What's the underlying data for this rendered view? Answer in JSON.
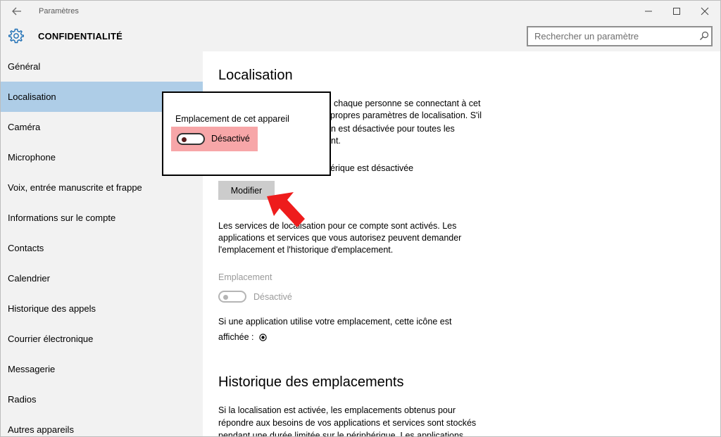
{
  "window": {
    "app_title": "Paramètres"
  },
  "header": {
    "section_title": "CONFIDENTIALITÉ",
    "search_placeholder": "Rechercher un paramètre"
  },
  "sidebar": {
    "active_index": 1,
    "items": [
      {
        "label": "Général"
      },
      {
        "label": "Localisation"
      },
      {
        "label": "Caméra"
      },
      {
        "label": "Microphone"
      },
      {
        "label": "Voix, entrée manuscrite et frappe"
      },
      {
        "label": "Informations sur le compte"
      },
      {
        "label": "Contacts"
      },
      {
        "label": "Calendrier"
      },
      {
        "label": "Historique des appels"
      },
      {
        "label": "Courrier électronique"
      },
      {
        "label": "Messagerie"
      },
      {
        "label": "Radios"
      },
      {
        "label": "Autres appareils"
      }
    ]
  },
  "main": {
    "heading": "Localisation",
    "intro_lines": [
      "chaque personne se connectant à cet",
      "propres paramètres de localisation. S'il",
      "n est désactivée pour toutes les",
      "nt."
    ],
    "device_status_line": "érique est désactivée",
    "modify_label": "Modifier",
    "account_lines": [
      "Les services de localisation pour ce compte sont activés. Les",
      "applications et services que vous autorisez peuvent demander",
      "l'emplacement et l'historique d'emplacement."
    ],
    "location_label": "Emplacement",
    "location_toggle": {
      "state": "Désactivé",
      "on": false
    },
    "icon_note_lines": [
      "Si une application utilise votre emplacement, cette icône est",
      "affichée :"
    ],
    "history_heading": "Historique des emplacements",
    "history_lines": [
      "Si la localisation est activée, les emplacements obtenus pour",
      "répondre aux besoins de vos applications et services sont stockés",
      "pendant une durée limitée sur le périphérique. Les applications"
    ]
  },
  "callout": {
    "title": "Emplacement de cet appareil",
    "toggle_state": "Désactivé",
    "toggle_on": false
  },
  "colors": {
    "chrome": "#f2f2f2",
    "active_nav": "#aecde7",
    "highlight": "#f7a6a8",
    "arrow": "#ee1c1c",
    "button": "#cccccc"
  },
  "icons": {
    "back": "back-arrow-icon",
    "minimize": "minimize-icon",
    "maximize": "maximize-icon",
    "close": "close-icon",
    "gear": "gear-icon",
    "search": "search-icon",
    "location_indicator": "location-indicator-icon",
    "annotation_arrow": "annotation-arrow-icon"
  }
}
